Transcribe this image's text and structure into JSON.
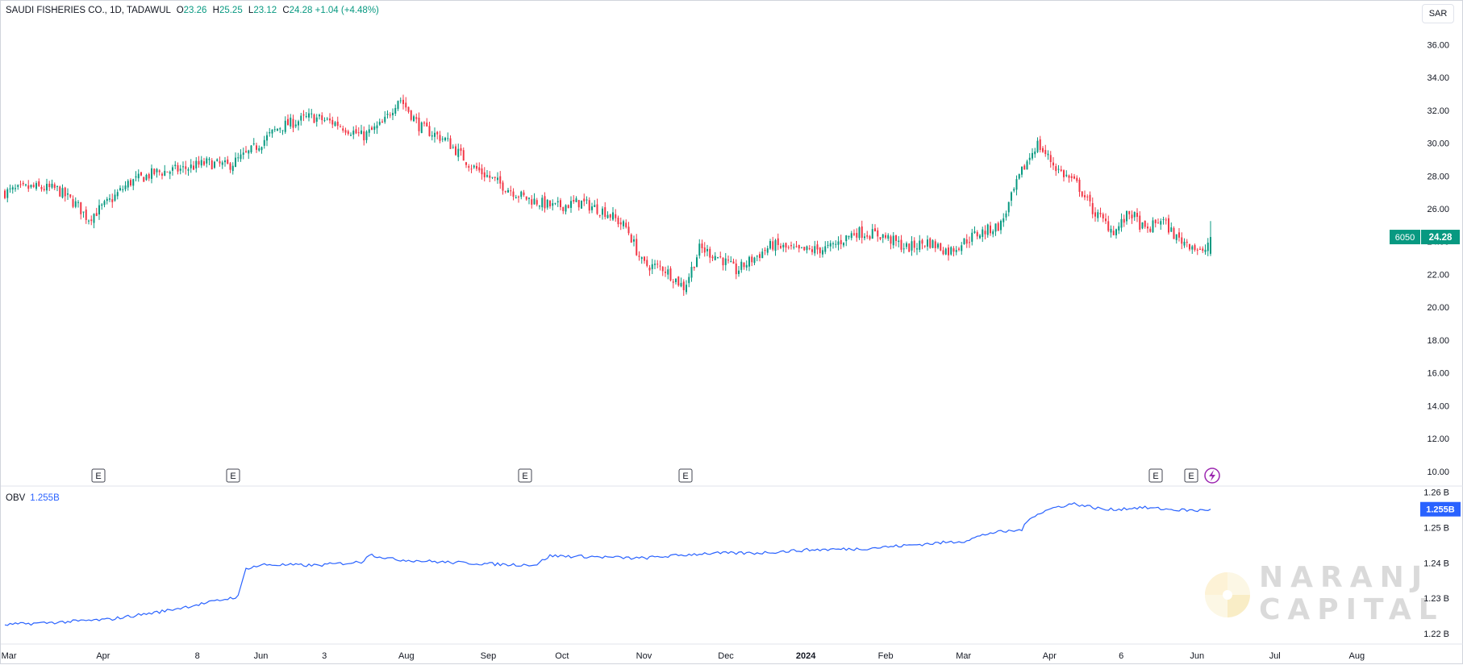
{
  "header": {
    "symbol": "SAUDI FISHERIES CO., 1D, TADAWUL",
    "open_label": "O",
    "open": "23.26",
    "high_label": "H",
    "high": "25.25",
    "low_label": "L",
    "low": "23.12",
    "close_label": "C",
    "close": "24.28",
    "change": "+1.04 (+4.48%)",
    "currency_button": "SAR"
  },
  "price_badges": {
    "ticker_code": "6050",
    "last_price": "24.28"
  },
  "obv": {
    "label": "OBV",
    "value": "1.255B",
    "badge": "1.255B"
  },
  "events": {
    "earnings_marker": "E",
    "dividend_icon": "lightning-icon"
  },
  "brand": {
    "line1": "NARANJ",
    "line2": "CAPITAL"
  },
  "colors": {
    "up": "#089981",
    "down": "#f23645",
    "obv_line": "#2962ff",
    "badge": "#089981",
    "grid": "#f0f3fa"
  },
  "chart_data": [
    {
      "type": "candlestick",
      "title": "SAUDI FISHERIES CO., 1D, TADAWUL",
      "y_axis_ticks": [
        "36.00",
        "34.00",
        "32.00",
        "30.00",
        "28.00",
        "26.00",
        "24.00",
        "22.00",
        "20.00",
        "18.00",
        "16.00",
        "14.00",
        "12.00",
        "10.00"
      ],
      "ylim": [
        9.4,
        37.2
      ],
      "x_axis_ticks": [
        "Mar",
        "Apr",
        "8",
        "Jun",
        "3",
        "Aug",
        "Sep",
        "Oct",
        "Nov",
        "Dec",
        "2024",
        "Feb",
        "Mar",
        "Apr",
        "6",
        "Jun",
        "Jul",
        "Aug"
      ],
      "last_close": 24.28,
      "price_path": [
        [
          0,
          27.0
        ],
        [
          10,
          27.3
        ],
        [
          20,
          27.2
        ],
        [
          28,
          26.2
        ],
        [
          32,
          25.4
        ],
        [
          40,
          26.4
        ],
        [
          48,
          27.6
        ],
        [
          58,
          28.2
        ],
        [
          68,
          28.4
        ],
        [
          78,
          28.8
        ],
        [
          86,
          28.6
        ],
        [
          94,
          29.4
        ],
        [
          106,
          31.0
        ],
        [
          118,
          31.6
        ],
        [
          128,
          31.2
        ],
        [
          138,
          30.4
        ],
        [
          146,
          31.2
        ],
        [
          152,
          32.8
        ],
        [
          160,
          31.0
        ],
        [
          170,
          30.2
        ],
        [
          180,
          28.6
        ],
        [
          190,
          27.6
        ],
        [
          200,
          26.7
        ],
        [
          212,
          26.1
        ],
        [
          222,
          26.4
        ],
        [
          232,
          25.8
        ],
        [
          240,
          24.8
        ],
        [
          246,
          22.6
        ],
        [
          254,
          22.4
        ],
        [
          262,
          21.2
        ],
        [
          268,
          23.6
        ],
        [
          276,
          23.0
        ],
        [
          282,
          22.2
        ],
        [
          288,
          22.9
        ],
        [
          296,
          23.8
        ],
        [
          306,
          23.4
        ],
        [
          318,
          23.6
        ],
        [
          328,
          24.6
        ],
        [
          338,
          24.4
        ],
        [
          348,
          23.6
        ],
        [
          356,
          24.0
        ],
        [
          364,
          23.4
        ],
        [
          374,
          24.4
        ],
        [
          384,
          25.0
        ],
        [
          392,
          28.2
        ],
        [
          398,
          30.0
        ],
        [
          406,
          28.4
        ],
        [
          414,
          27.4
        ],
        [
          420,
          25.8
        ],
        [
          428,
          24.6
        ],
        [
          434,
          25.8
        ],
        [
          440,
          24.6
        ],
        [
          446,
          25.4
        ],
        [
          452,
          24.2
        ],
        [
          458,
          23.8
        ],
        [
          462,
          23.2
        ],
        [
          465,
          24.28
        ]
      ],
      "candle_count": 460
    },
    {
      "type": "line",
      "name": "OBV",
      "y_axis_ticks": [
        "1.26 B",
        "1.25 B",
        "1.24 B",
        "1.23 B",
        "1.22 B"
      ],
      "ylim": [
        1.2175,
        1.2613
      ],
      "last_value": 1.2552,
      "path": [
        [
          0,
          1.2225
        ],
        [
          20,
          1.2232
        ],
        [
          40,
          1.224
        ],
        [
          60,
          1.2262
        ],
        [
          80,
          1.229
        ],
        [
          90,
          1.2305
        ],
        [
          93,
          1.2385
        ],
        [
          100,
          1.2395
        ],
        [
          120,
          1.2393
        ],
        [
          138,
          1.2403
        ],
        [
          140,
          1.2425
        ],
        [
          150,
          1.241
        ],
        [
          170,
          1.2402
        ],
        [
          195,
          1.2395
        ],
        [
          205,
          1.2395
        ],
        [
          210,
          1.242
        ],
        [
          225,
          1.2418
        ],
        [
          245,
          1.2413
        ],
        [
          270,
          1.2427
        ],
        [
          290,
          1.2428
        ],
        [
          310,
          1.2437
        ],
        [
          330,
          1.244
        ],
        [
          345,
          1.2448
        ],
        [
          370,
          1.2462
        ],
        [
          380,
          1.2485
        ],
        [
          392,
          1.2493
        ],
        [
          396,
          1.2532
        ],
        [
          404,
          1.2555
        ],
        [
          412,
          1.2568
        ],
        [
          425,
          1.255
        ],
        [
          438,
          1.2557
        ],
        [
          452,
          1.255
        ],
        [
          460,
          1.2548
        ],
        [
          465,
          1.2552
        ]
      ]
    }
  ]
}
